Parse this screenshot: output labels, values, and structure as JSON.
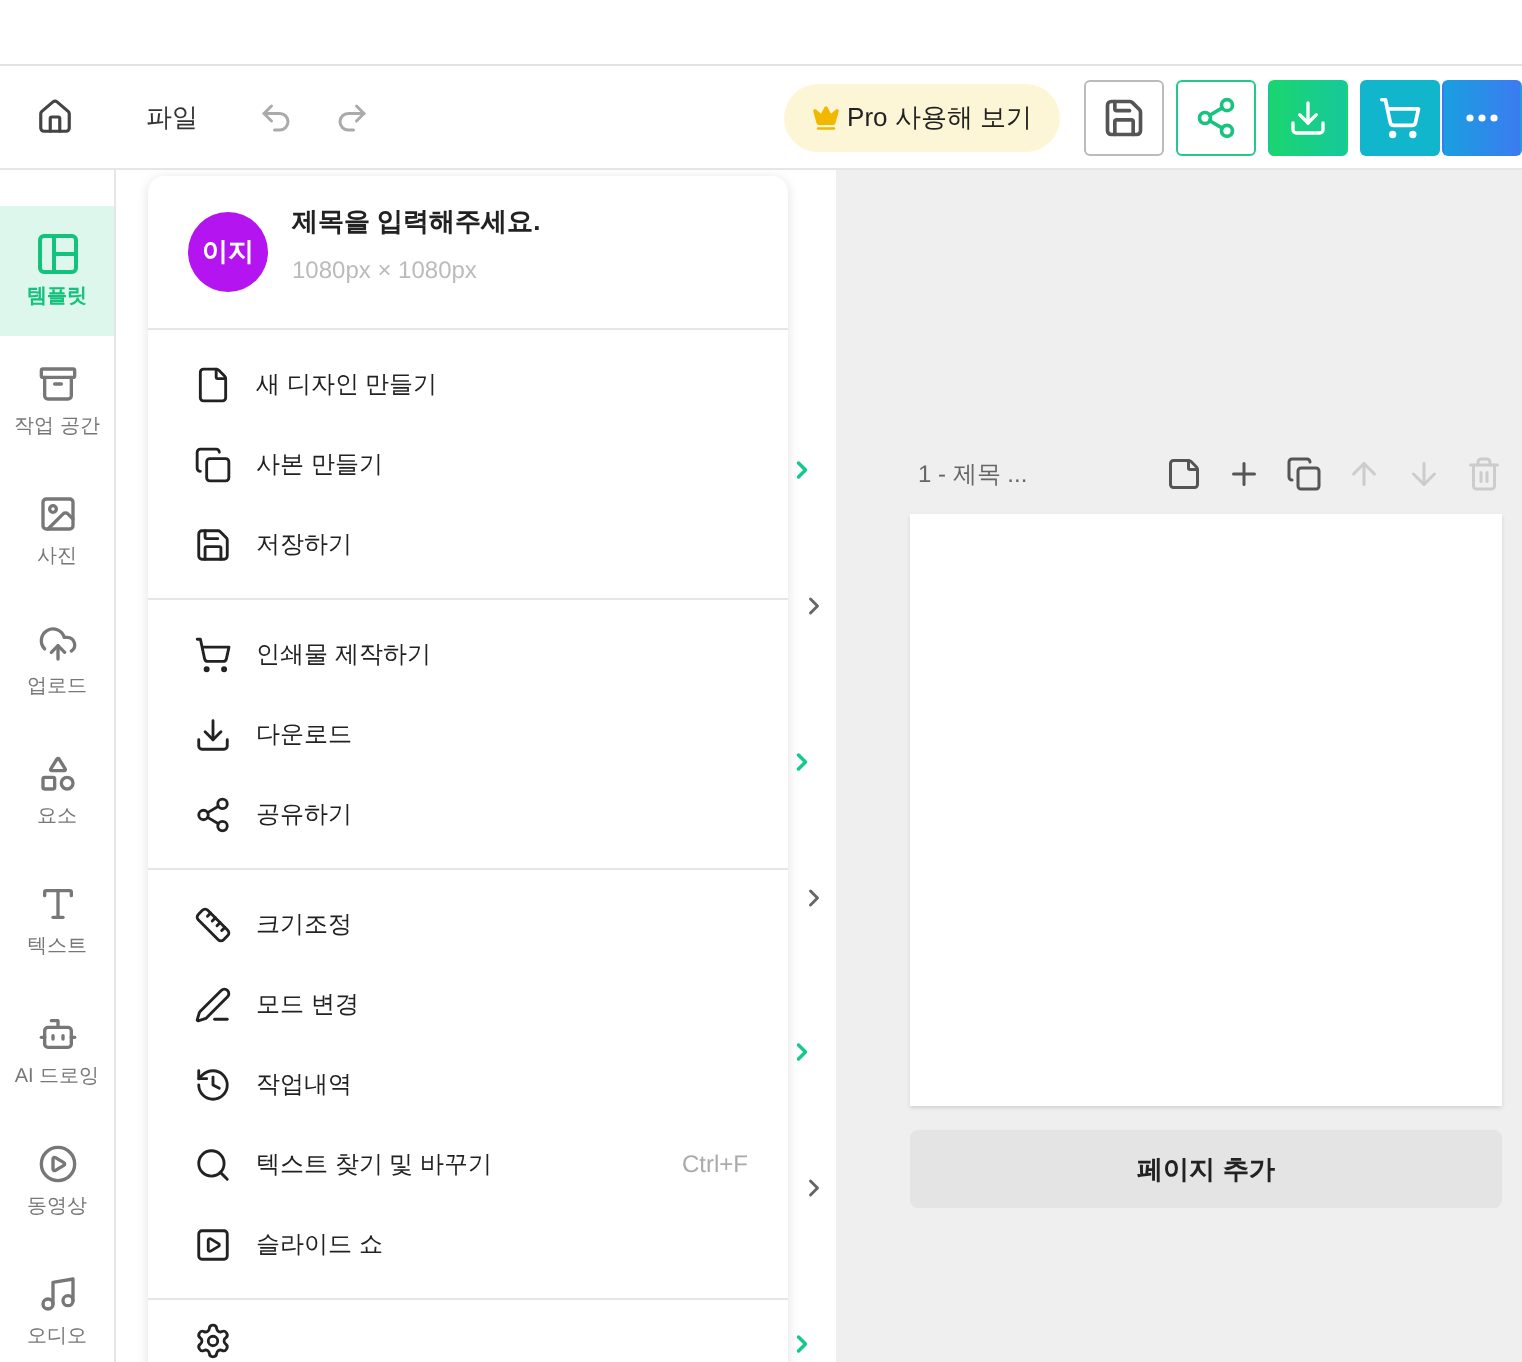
{
  "toolbar": {
    "file_menu": "파일",
    "pro_button": "Pro 사용해 보기"
  },
  "sidebar": {
    "items": [
      {
        "label": "템플릿",
        "selected": true
      },
      {
        "label": "작업 공간",
        "selected": false
      },
      {
        "label": "사진",
        "selected": false
      },
      {
        "label": "업로드",
        "selected": false
      },
      {
        "label": "요소",
        "selected": false
      },
      {
        "label": "텍스트",
        "selected": false
      },
      {
        "label": "AI 드로잉",
        "selected": false
      },
      {
        "label": "동영상",
        "selected": false
      },
      {
        "label": "오디오",
        "selected": false
      }
    ]
  },
  "file_menu": {
    "avatar": "이지",
    "title": "제목을 입력해주세요.",
    "dimensions": "1080px × 1080px",
    "sections": [
      [
        {
          "label": "새 디자인 만들기"
        },
        {
          "label": "사본 만들기"
        },
        {
          "label": "저장하기"
        }
      ],
      [
        {
          "label": "인쇄물 제작하기"
        },
        {
          "label": "다운로드"
        },
        {
          "label": "공유하기"
        }
      ],
      [
        {
          "label": "크기조정"
        },
        {
          "label": "모드 변경"
        },
        {
          "label": "작업내역"
        },
        {
          "label": "텍스트 찾기 및 바꾸기",
          "shortcut": "Ctrl+F"
        },
        {
          "label": "슬라이드 쇼"
        }
      ]
    ]
  },
  "page_panel": {
    "page_label": "1 - 제목 ...",
    "tools": [
      {
        "disabled": false
      },
      {
        "disabled": false
      },
      {
        "disabled": false
      },
      {
        "disabled": true
      },
      {
        "disabled": true
      },
      {
        "disabled": true
      }
    ],
    "add_page_button": "페이지 추가"
  }
}
